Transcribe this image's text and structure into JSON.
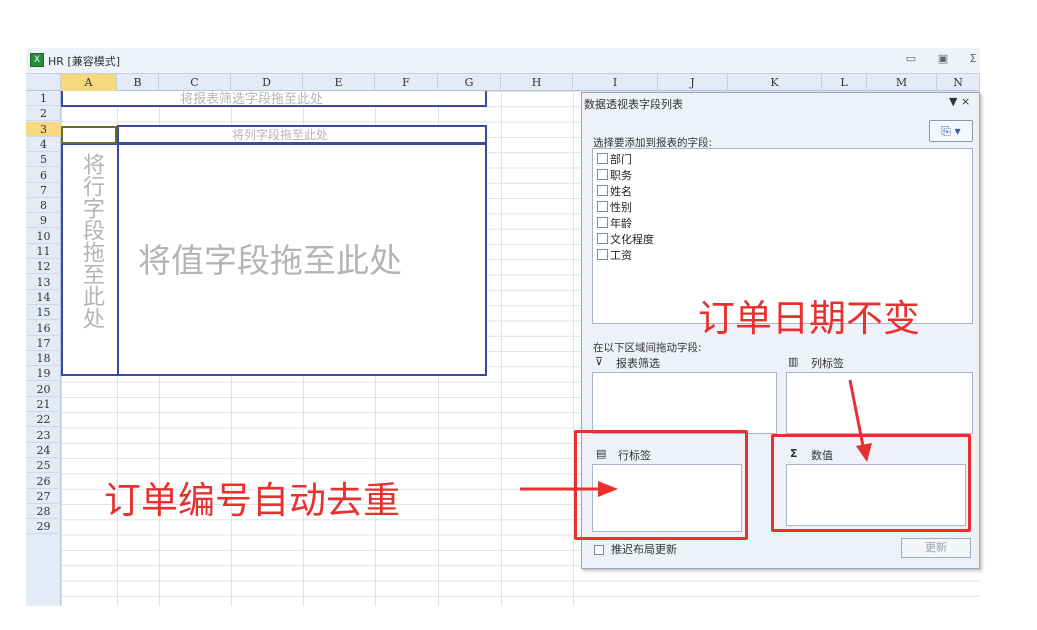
{
  "window": {
    "app_icon": "excel-icon",
    "title": "HR [兼容模式]",
    "controls": [
      "▭",
      "▣",
      "Σ"
    ]
  },
  "columns": [
    "A",
    "B",
    "C",
    "D",
    "E",
    "F",
    "G",
    "H",
    "I",
    "J",
    "K",
    "L",
    "M",
    "N"
  ],
  "rows": [
    "1",
    "2",
    "3",
    "4",
    "5",
    "6",
    "7",
    "8",
    "9",
    "10",
    "11",
    "12",
    "13",
    "14",
    "15",
    "16",
    "17",
    "18",
    "19",
    "20",
    "21",
    "22",
    "23",
    "24",
    "25",
    "26",
    "27",
    "28",
    "29"
  ],
  "selected_cell": {
    "column": "A",
    "row": "3"
  },
  "pivot": {
    "report_filter_placeholder": "将报表筛选字段拖至此处",
    "column_placeholder": "将列字段拖至此处",
    "row_placeholder": "将行字段拖至此处",
    "value_placeholder": "将值字段拖至此处"
  },
  "field_panel": {
    "title": "数据透视表字段列表",
    "close_glyph": "▼ ×",
    "settings_glyph": "⎘ ▾",
    "choose_label": "选择要添加到报表的字段:",
    "fields": [
      "部门",
      "职务",
      "姓名",
      "性别",
      "年龄",
      "文化程度",
      "工资"
    ],
    "drag_label": "在以下区域间拖动字段:",
    "zones": {
      "report_filter": {
        "icon": "filter-icon",
        "glyph": "⊽",
        "label": "报表筛选"
      },
      "column_labels": {
        "icon": "column-labels-icon",
        "glyph": "▥",
        "label": "列标签"
      },
      "row_labels": {
        "icon": "row-labels-icon",
        "glyph": "▤",
        "label": "行标签"
      },
      "values": {
        "icon": "sigma-icon",
        "glyph": "Σ",
        "label": "数值"
      }
    },
    "defer_label": "推迟布局更新",
    "update_button": "更新"
  },
  "annotations": {
    "color": "#e8312f",
    "top_note": "订单日期不变",
    "left_note": "订单编号自动去重"
  }
}
